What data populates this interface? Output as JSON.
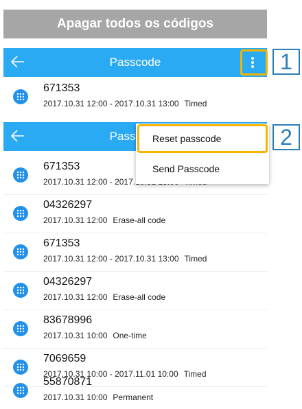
{
  "banner": {
    "title": "Apagar todos os códigos"
  },
  "appbar": {
    "title": "Passcode",
    "back_icon": "back-arrow-icon",
    "more_icon": "more-vert-icon",
    "color": "#2baaf4"
  },
  "callouts": [
    "1",
    "2"
  ],
  "menu": {
    "items": [
      "Reset passcode",
      "Send Passcode"
    ]
  },
  "top_row": {
    "code": "671353",
    "date": "2017.10.31 12:00 - 2017.10.31 13:00",
    "kind": "Timed"
  },
  "list": [
    {
      "code": "671353",
      "date": "2017.10.31 12:00 - 2017.10.31 13:00",
      "kind": "Timed"
    },
    {
      "code": "04326297",
      "date": "2017.10.31 12:00",
      "kind": "Erase-all code"
    },
    {
      "code": "671353",
      "date": "2017.10.31 12:00 - 2017.10.31 13:00",
      "kind": "Timed"
    },
    {
      "code": "04326297",
      "date": "2017.10.31 12:00",
      "kind": "Erase-all code"
    },
    {
      "code": "83678996",
      "date": "2017.10.31 10:00",
      "kind": "One-time"
    },
    {
      "code": "7069659",
      "date": "2017.10.31 10:00 - 2017.11.01 10:00",
      "kind": "Timed"
    },
    {
      "code": "55870871",
      "date": "2017.10.31 10:00",
      "kind": "Permanent"
    }
  ]
}
